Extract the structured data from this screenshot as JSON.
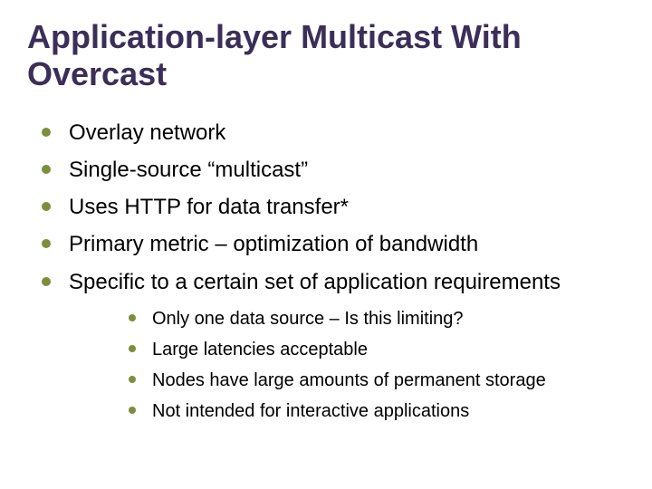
{
  "title": "Application-layer Multicast With Overcast",
  "bullets": [
    "Overlay network",
    "Single-source “multicast”",
    "Uses HTTP for data transfer*",
    "Primary metric – optimization of bandwidth",
    "Specific to a certain set of application requirements"
  ],
  "sub_bullets": [
    "Only one data source – Is this limiting?",
    "Large latencies acceptable",
    "Nodes have large amounts of permanent storage",
    "Not intended for interactive applications"
  ]
}
